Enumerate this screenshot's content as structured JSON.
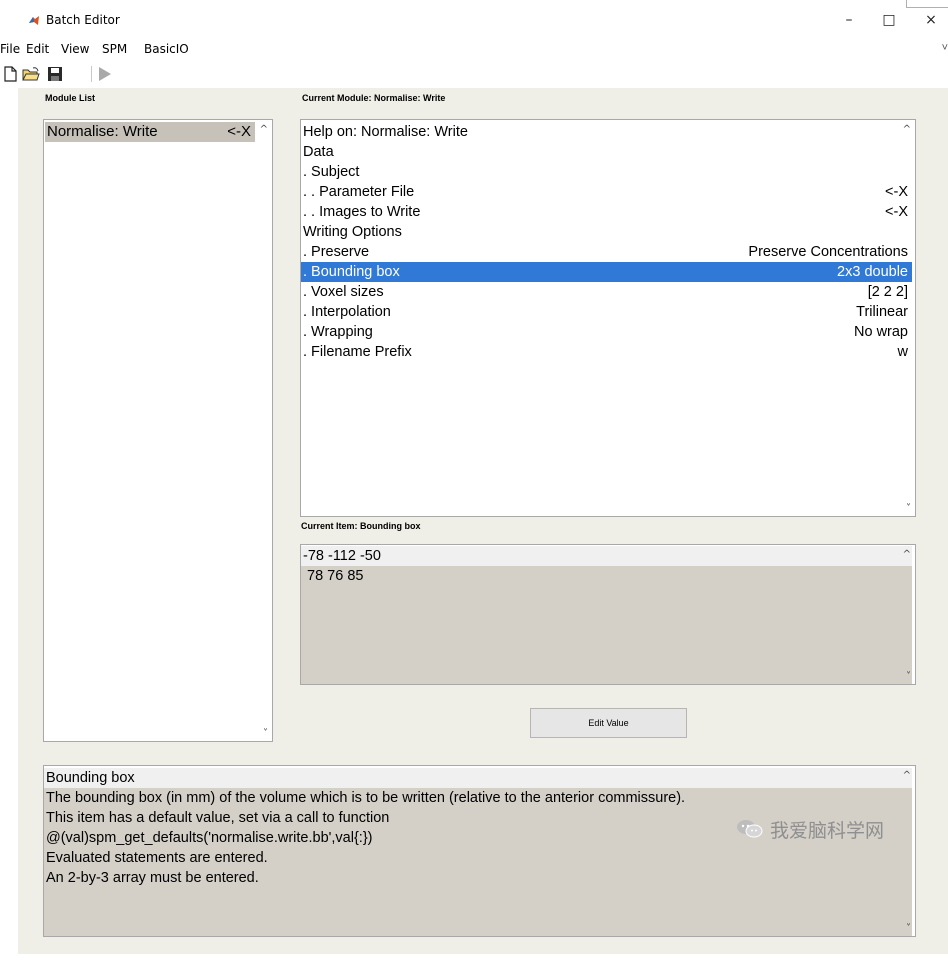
{
  "window": {
    "title": "Batch Editor",
    "controls": {
      "minimize": "–",
      "maximize": "□",
      "close": "×"
    }
  },
  "menu": {
    "items": [
      "File",
      "Edit",
      "View",
      "SPM",
      "BasicIO"
    ],
    "edge": "˅"
  },
  "toolbar": {
    "icons": [
      "new-file-icon",
      "open-folder-icon",
      "save-icon",
      "run-icon"
    ]
  },
  "module_list": {
    "label": "Module List",
    "items": [
      {
        "label": "Normalise: Write",
        "value": "<-X"
      }
    ]
  },
  "current_module": {
    "label": "Current Module: Normalise: Write",
    "rows": [
      {
        "label": "Help on: Normalise: Write",
        "value": ""
      },
      {
        "label": "Data",
        "value": ""
      },
      {
        "label": ". Subject",
        "value": ""
      },
      {
        "label": ". . Parameter File",
        "value": "<-X"
      },
      {
        "label": ". . Images to Write",
        "value": "<-X"
      },
      {
        "label": "Writing Options",
        "value": ""
      },
      {
        "label": ". Preserve",
        "value": "Preserve Concentrations"
      },
      {
        "label": ". Bounding box",
        "value": "2x3 double",
        "selected": true
      },
      {
        "label": ". Voxel sizes",
        "value": "[2 2 2]"
      },
      {
        "label": ". Interpolation",
        "value": "Trilinear"
      },
      {
        "label": ". Wrapping",
        "value": "No wrap"
      },
      {
        "label": ". Filename Prefix",
        "value": "w"
      }
    ]
  },
  "current_item": {
    "label": "Current Item: Bounding box",
    "lines": [
      "-78 -112  -50",
      "78  76  85"
    ]
  },
  "edit_button": {
    "label": "Edit Value"
  },
  "help": {
    "lines": [
      "Bounding box",
      "The bounding box (in mm) of the volume which is to be written (relative to the anterior commissure).",
      "This item has a default value, set via a call to function",
      "@(val)spm_get_defaults('normalise.write.bb',val{:})",
      "Evaluated statements are entered.",
      "An 2-by-3 array must be entered."
    ]
  },
  "scroll": {
    "up": "^",
    "down": "˅"
  },
  "watermark": {
    "text": "我爱脑科学网"
  },
  "colors": {
    "selection": "#3079d6",
    "panel": "#f0efe7",
    "gray": "#d4d0c8"
  }
}
